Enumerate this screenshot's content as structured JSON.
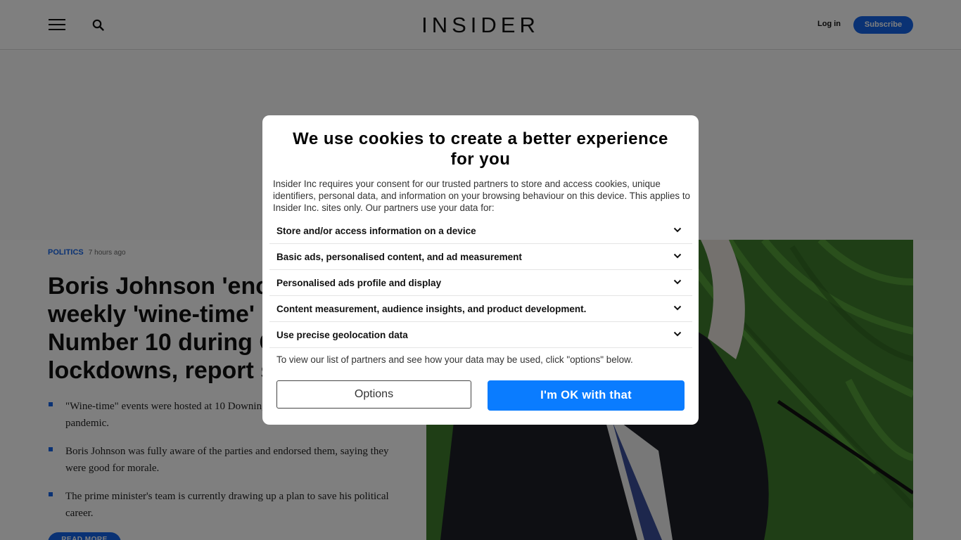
{
  "header": {
    "logo": "INSIDER",
    "login_label": "Log in",
    "subscribe_label": "Subscribe"
  },
  "article": {
    "category": "POLITICS",
    "time": "7 hours ago",
    "headline": "Boris Johnson 'encouraged' weekly 'wine-time' parties at Number 10 during COVID lockdowns, report says",
    "bullets": [
      "\"Wine-time\" events were hosted at 10 Downing Street every Friday during the pandemic.",
      "Boris Johnson was fully aware of the parties and endorsed them, saying they were good for morale.",
      "The prime minister's team is currently drawing up a plan to save his political career."
    ],
    "read_more_label": "READ MORE"
  },
  "consent": {
    "title": "We use cookies to create a better experience for you",
    "body": "Insider Inc requires your consent for our trusted partners to store and access cookies, unique identifiers, personal data, and information on your browsing behaviour on this device. This applies to Insider Inc. sites only. Our partners use your data for:",
    "purposes": [
      "Store and/or access information on a device",
      "Basic ads, personalised content, and ad measurement",
      "Personalised ads profile and display",
      "Content measurement, audience insights, and product development.",
      "Use precise geolocation data"
    ],
    "partners_note": "To view our list of partners and see how your data may be used, click \"options\" below.",
    "options_label": "Options",
    "accept_label": "I'm OK with that"
  },
  "colors": {
    "brand_blue": "#1565e8",
    "accept_blue": "#0a7cff",
    "overlay": "rgba(0,0,0,0.5)"
  },
  "icons": {
    "menu": "hamburger-icon",
    "search": "search-icon",
    "expand": "chevron-down-icon"
  }
}
